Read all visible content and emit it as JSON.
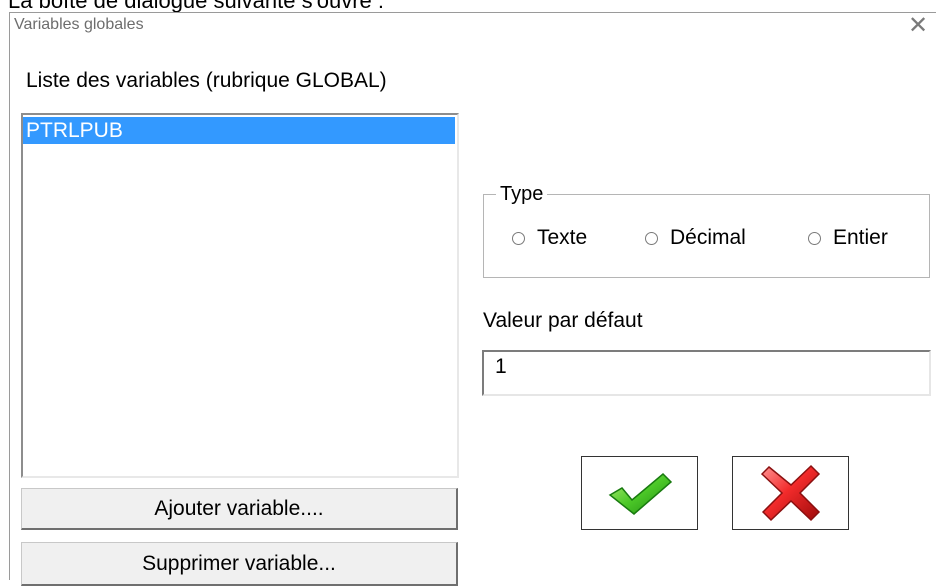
{
  "context": {
    "doc_text": "La boîte de dialogue suivante s'ouvre :"
  },
  "window": {
    "title": "Variables globales",
    "close_glyph": "✕"
  },
  "variables": {
    "label": "Liste des variables (rubrique GLOBAL)",
    "items": [
      "PTRLPUB"
    ],
    "selected_index": 0
  },
  "buttons": {
    "add_label": "Ajouter variable....",
    "delete_label": "Supprimer variable..."
  },
  "type_group": {
    "label": "Type",
    "options": [
      "Texte",
      "Décimal",
      "Entier"
    ]
  },
  "default_value": {
    "label": "Valeur par défaut",
    "value": "1"
  },
  "actions": {
    "ok_icon": "checkmark-icon",
    "cancel_icon": "red-x-icon"
  },
  "colors": {
    "selection": "#3399ff",
    "ok_green": "#34b11f",
    "cancel_red": "#e4282f"
  }
}
